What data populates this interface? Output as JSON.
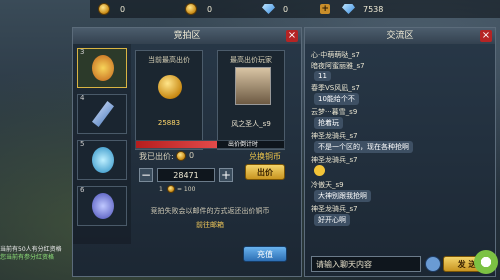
{
  "topbar": {
    "coin1": "0",
    "coin2": "0",
    "gem1": "0",
    "gem2": "7538"
  },
  "auction": {
    "title": "竞拍区",
    "slots": [
      {
        "num": "3",
        "selected": true
      },
      {
        "num": "4"
      },
      {
        "num": "5"
      },
      {
        "num": "6"
      }
    ],
    "highest_bid_label": "当前最高出价",
    "highest_bid_value": "25883",
    "highest_player_label": "最高出价玩家",
    "highest_player_name": "风之圣人_s9",
    "progress_text": "出价倒计时",
    "progress_fraction": 0.55,
    "my_bid_label": "我已出价:",
    "my_bid_value": "0",
    "exchange_label": "兑换铜币",
    "quantity": "28471",
    "rate_text": "1",
    "rate_value": "= 100",
    "bid_button": "出价",
    "mail_info": "竞拍失败会以邮件的方式返还出价铜币",
    "mail_link": "前往邮箱",
    "recharge_button": "充值"
  },
  "chat": {
    "title": "交流区",
    "messages": [
      {
        "name": "心·中萌萌哒_s7",
        "bubble": ""
      },
      {
        "name": "暗夜阿蜜丽雅_s7",
        "bubble": "11"
      },
      {
        "name": "春季VS风凪_s7",
        "bubble": "10能给个不"
      },
      {
        "name": "云梦···暮雪_s9",
        "bubble": "抢着玩"
      },
      {
        "name": "神圣龙骑兵_s7",
        "bubble": "不是一个区的，现在各种抢啊"
      },
      {
        "name": "神圣龙骑兵_s7",
        "bubble": ""
      },
      {
        "name": "冷傲天_s9",
        "bubble": "大神别跟我抢啊"
      },
      {
        "name": "神圣龙骑兵_s7",
        "bubble": "好开心啊"
      }
    ],
    "input_placeholder": "请输入聊天内容",
    "send_button": "发 送"
  },
  "bottom_notice": {
    "line1": "当前有50人有分红资格",
    "line2": "您当前有参分红资格"
  }
}
